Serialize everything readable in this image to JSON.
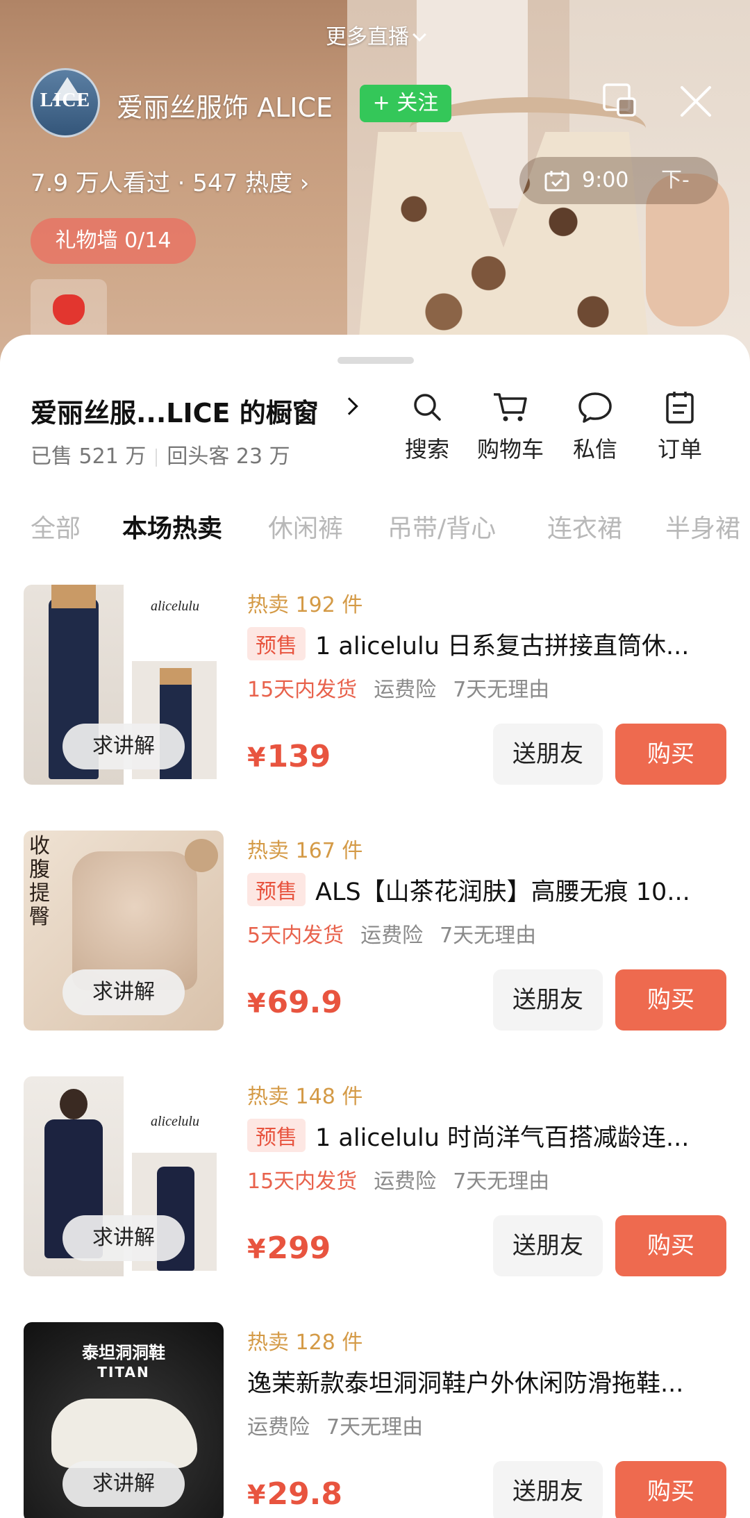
{
  "live": {
    "more_live": "更多直播",
    "shop_name": "爱丽丝服饰 ALICE",
    "avatar_text": "LICE",
    "follow_label": "+ 关注",
    "viewers": "7.9 万人看过 · 547 热度 ›",
    "schedule_time": "9:00",
    "schedule_next": "下-",
    "gift_wall": "礼物墙 0/14"
  },
  "store": {
    "title": "爱丽丝服...LICE 的橱窗",
    "sold": "已售 521 万",
    "repeat": "回头客 23 万",
    "tools": [
      {
        "label": "搜索",
        "icon": "search-icon"
      },
      {
        "label": "购物车",
        "icon": "cart-icon"
      },
      {
        "label": "私信",
        "icon": "message-icon"
      },
      {
        "label": "订单",
        "icon": "order-icon"
      }
    ]
  },
  "tabs": [
    "全部",
    "本场热卖",
    "休闲裤",
    "吊带/背心",
    "连衣裙",
    "半身裙"
  ],
  "active_tab": "本场热卖",
  "product_labels": {
    "explain": "求讲解",
    "gift": "送朋友",
    "buy": "购买",
    "presale": "预售",
    "currency": "¥"
  },
  "products": [
    {
      "hot": "热卖 192 件",
      "presale": true,
      "title": "1 alicelulu 日系复古拼接直筒休...",
      "shipping": "15天内发货",
      "insurance": "运费险",
      "return": "7天无理由",
      "price": "139",
      "thumb_text": "alicelulu"
    },
    {
      "hot": "热卖 167 件",
      "presale": true,
      "title": "ALS【山茶花润肤】高腰无痕 10...",
      "shipping": "5天内发货",
      "insurance": "运费险",
      "return": "7天无理由",
      "price": "69.9",
      "thumb_text": "收腹提臀"
    },
    {
      "hot": "热卖 148 件",
      "presale": true,
      "title": "1 alicelulu 时尚洋气百搭减龄连...",
      "shipping": "15天内发货",
      "insurance": "运费险",
      "return": "7天无理由",
      "price": "299",
      "thumb_text": "alicelulu"
    },
    {
      "hot": "热卖 128 件",
      "presale": false,
      "title": "逸茉新款泰坦洞洞鞋户外休闲防滑拖鞋...",
      "shipping": "",
      "insurance": "运费险",
      "return": "7天无理由",
      "price": "29.8",
      "thumb_text": "泰坦洞洞鞋",
      "thumb_subtext": "TITAN"
    }
  ]
}
